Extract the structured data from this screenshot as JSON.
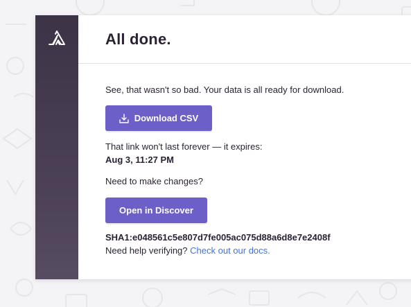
{
  "header": {
    "title": "All done."
  },
  "intro_text": "See, that wasn't so bad. Your data is all ready for download.",
  "download_button": {
    "label": "Download CSV",
    "icon": "download-icon"
  },
  "expiry": {
    "text": "That link won't last forever — it expires:",
    "date": "Aug 3, 11:27 PM"
  },
  "changes_text": "Need to make changes?",
  "discover_button": {
    "label": "Open in Discover"
  },
  "checksum": "SHA1:e048561c5e807d7fe005ac075d88a6d8e7e2408f",
  "help": {
    "text": "Need help verifying?",
    "link_label": "Check out our docs."
  },
  "colors": {
    "accent": "#6c5fc7",
    "sidebar": "#3d3346",
    "link": "#3d74db"
  }
}
